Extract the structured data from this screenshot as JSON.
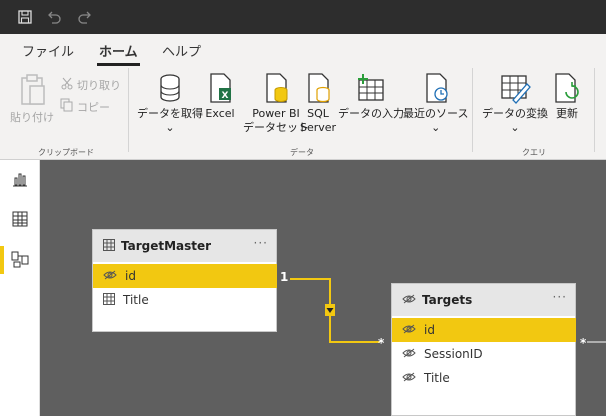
{
  "ribbon": {
    "tabs": [
      {
        "label": "ファイル"
      },
      {
        "label": "ホーム"
      },
      {
        "label": "ヘルプ"
      }
    ],
    "clipboard": {
      "paste_label": "貼り付け",
      "cut_label": "切り取り",
      "copy_label": "コピー",
      "group_label": "クリップボード"
    },
    "data": {
      "get_data_label": "データを取得",
      "excel_label": "Excel",
      "powerbi_label_1": "Power BI",
      "powerbi_label_2": "データセット",
      "sql_label_1": "SQL",
      "sql_label_2": "Server",
      "enter_data_label": "データの入力",
      "recent_label": "最近のソース",
      "group_label": "データ"
    },
    "query": {
      "transform_label": "データの変換",
      "refresh_label": "更新",
      "group_label": "クエリ"
    },
    "colors": {
      "accent": "#f2c811",
      "excel": "#217346",
      "titlebar": "#2d2d2d"
    }
  },
  "rail": {
    "items": [
      {
        "icon": "report-icon"
      },
      {
        "icon": "table-view-icon"
      },
      {
        "icon": "model-view-icon"
      }
    ]
  },
  "model": {
    "tables": [
      {
        "name": "TargetMaster",
        "more": "···",
        "fields": [
          {
            "name": "id",
            "selected": true,
            "icon": "hidden-eye-icon"
          },
          {
            "name": "Title",
            "selected": false,
            "icon": "table-column-icon"
          }
        ]
      },
      {
        "name": "Targets",
        "more": "···",
        "fields": [
          {
            "name": "id",
            "selected": true,
            "icon": "hidden-eye-icon"
          },
          {
            "name": "SessionID",
            "selected": false,
            "icon": "hidden-eye-icon"
          },
          {
            "name": "Title",
            "selected": false,
            "icon": "hidden-eye-icon"
          }
        ]
      }
    ],
    "relationship": {
      "from_cardinality": "1",
      "to_cardinality": "*",
      "extra_cardinality": "*"
    }
  }
}
